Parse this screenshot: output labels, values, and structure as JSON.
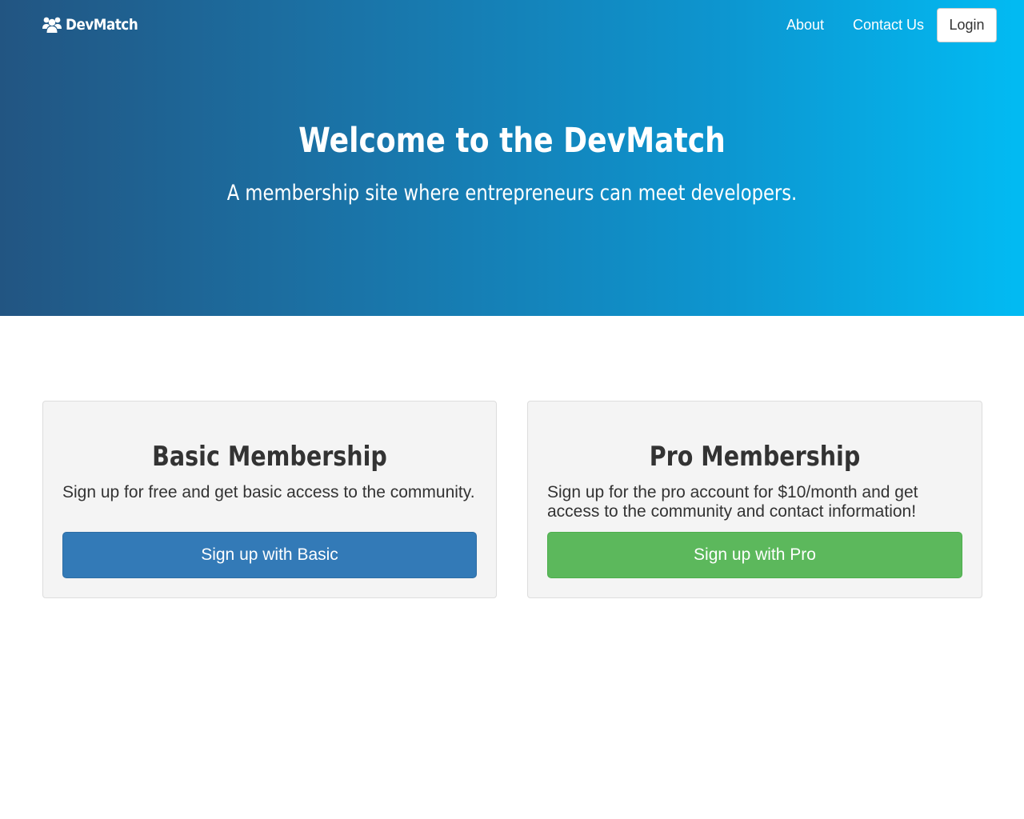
{
  "navbar": {
    "brand_icon": "users-icon",
    "brand": "DevMatch",
    "links": [
      {
        "label": "About"
      },
      {
        "label": "Contact Us"
      }
    ],
    "login_label": "Login"
  },
  "hero": {
    "title": "Welcome to the DevMatch",
    "subtitle": "A membership site where entrepreneurs can meet developers.",
    "gradient": [
      "#225582",
      "#02bbf3"
    ]
  },
  "plans": {
    "basic": {
      "title": "Basic Membership",
      "description": "Sign up for free and get basic access to the community.",
      "button_label": "Sign up with Basic",
      "button_color": "#337ab7"
    },
    "pro": {
      "title": "Pro Membership",
      "description": "Sign up for the pro account for $10/month and get access to the community and contact information!",
      "button_label": "Sign up with Pro",
      "button_color": "#5cb85c"
    }
  }
}
